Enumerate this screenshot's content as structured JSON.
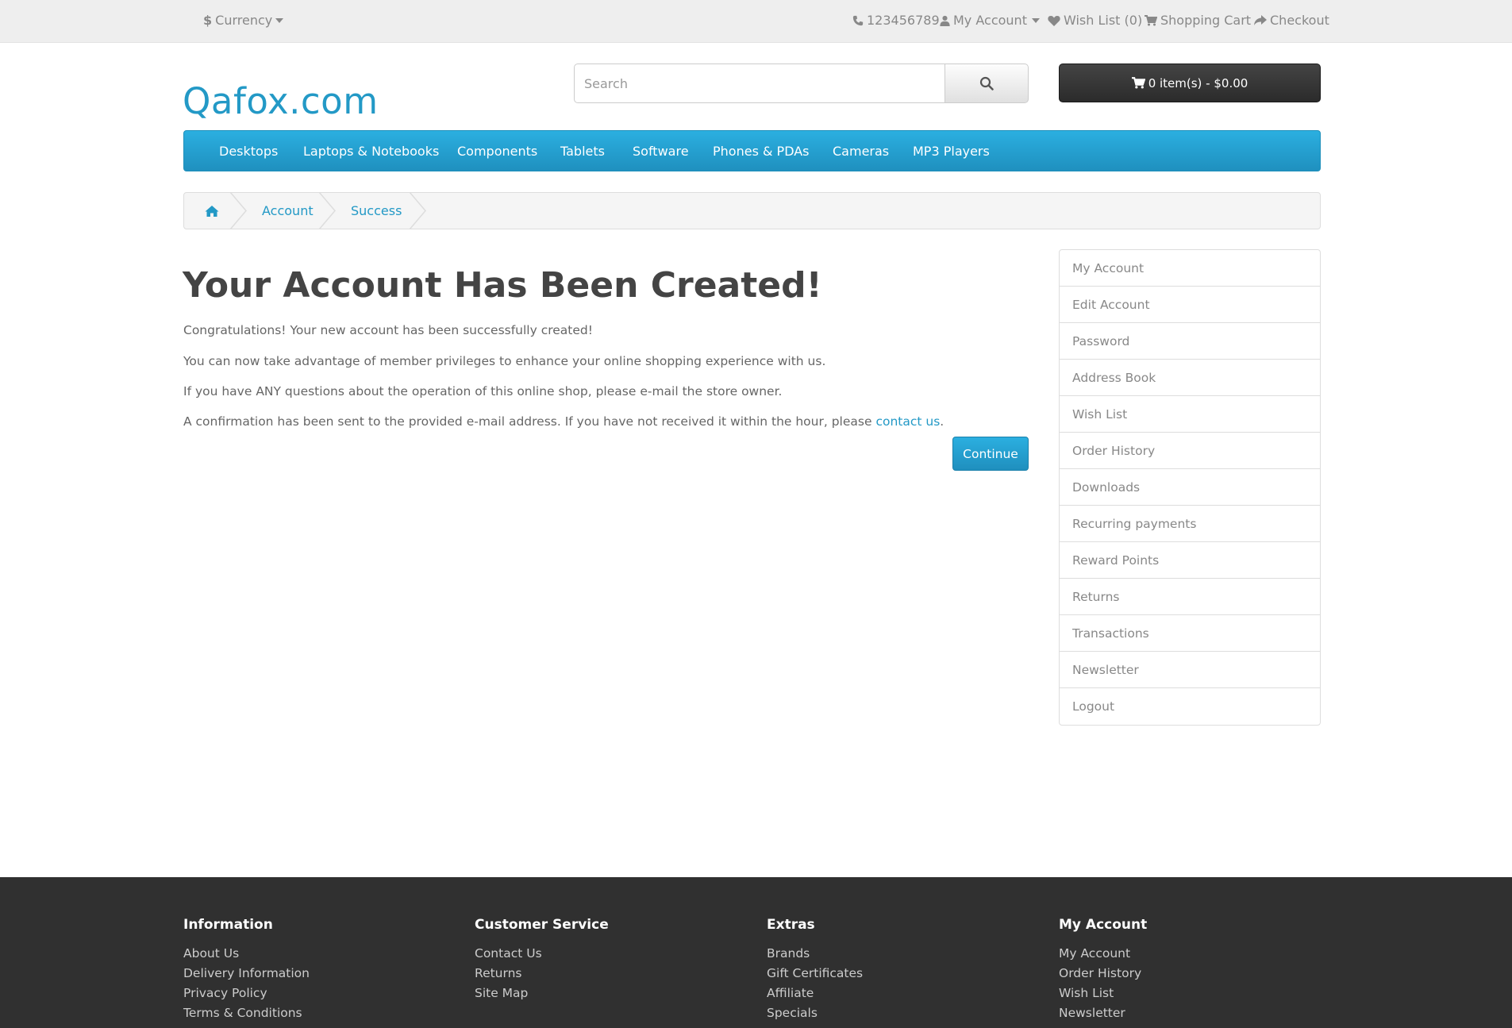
{
  "top_bar": {
    "currency_label": "Currency",
    "phone": "123456789",
    "my_account": "My Account",
    "wish_list": "Wish List (0)",
    "shopping_cart": "Shopping Cart",
    "checkout": "Checkout"
  },
  "header": {
    "logo": "Qafox.com",
    "search_placeholder": "Search",
    "cart_label": "0 item(s) - $0.00"
  },
  "menu": [
    "Desktops",
    "Laptops & Notebooks",
    "Components",
    "Tablets",
    "Software",
    "Phones & PDAs",
    "Cameras",
    "MP3 Players"
  ],
  "breadcrumb": [
    "Account",
    "Success"
  ],
  "main": {
    "title": "Your Account Has Been Created!",
    "paragraphs": [
      "Congratulations! Your new account has been successfully created!",
      "You can now take advantage of member privileges to enhance your online shopping experience with us.",
      "If you have ANY questions about the operation of this online shop, please e-mail the store owner."
    ],
    "confirmation_prefix": "A confirmation has been sent to the provided e-mail address. If you have not received it within the hour, please ",
    "contact_link": "contact us",
    "confirmation_suffix": ".",
    "continue_label": "Continue"
  },
  "sidebar": [
    "My Account",
    "Edit Account",
    "Password",
    "Address Book",
    "Wish List",
    "Order History",
    "Downloads",
    "Recurring payments",
    "Reward Points",
    "Returns",
    "Transactions",
    "Newsletter",
    "Logout"
  ],
  "footer": {
    "columns": [
      {
        "heading": "Information",
        "links": [
          "About Us",
          "Delivery Information",
          "Privacy Policy",
          "Terms & Conditions"
        ]
      },
      {
        "heading": "Customer Service",
        "links": [
          "Contact Us",
          "Returns",
          "Site Map"
        ]
      },
      {
        "heading": "Extras",
        "links": [
          "Brands",
          "Gift Certificates",
          "Affiliate",
          "Specials"
        ]
      },
      {
        "heading": "My Account",
        "links": [
          "My Account",
          "Order History",
          "Wish List",
          "Newsletter"
        ]
      }
    ]
  },
  "colors": {
    "accent": "#2399c6",
    "footer_bg": "#303030",
    "cart_bg": "#363636"
  }
}
